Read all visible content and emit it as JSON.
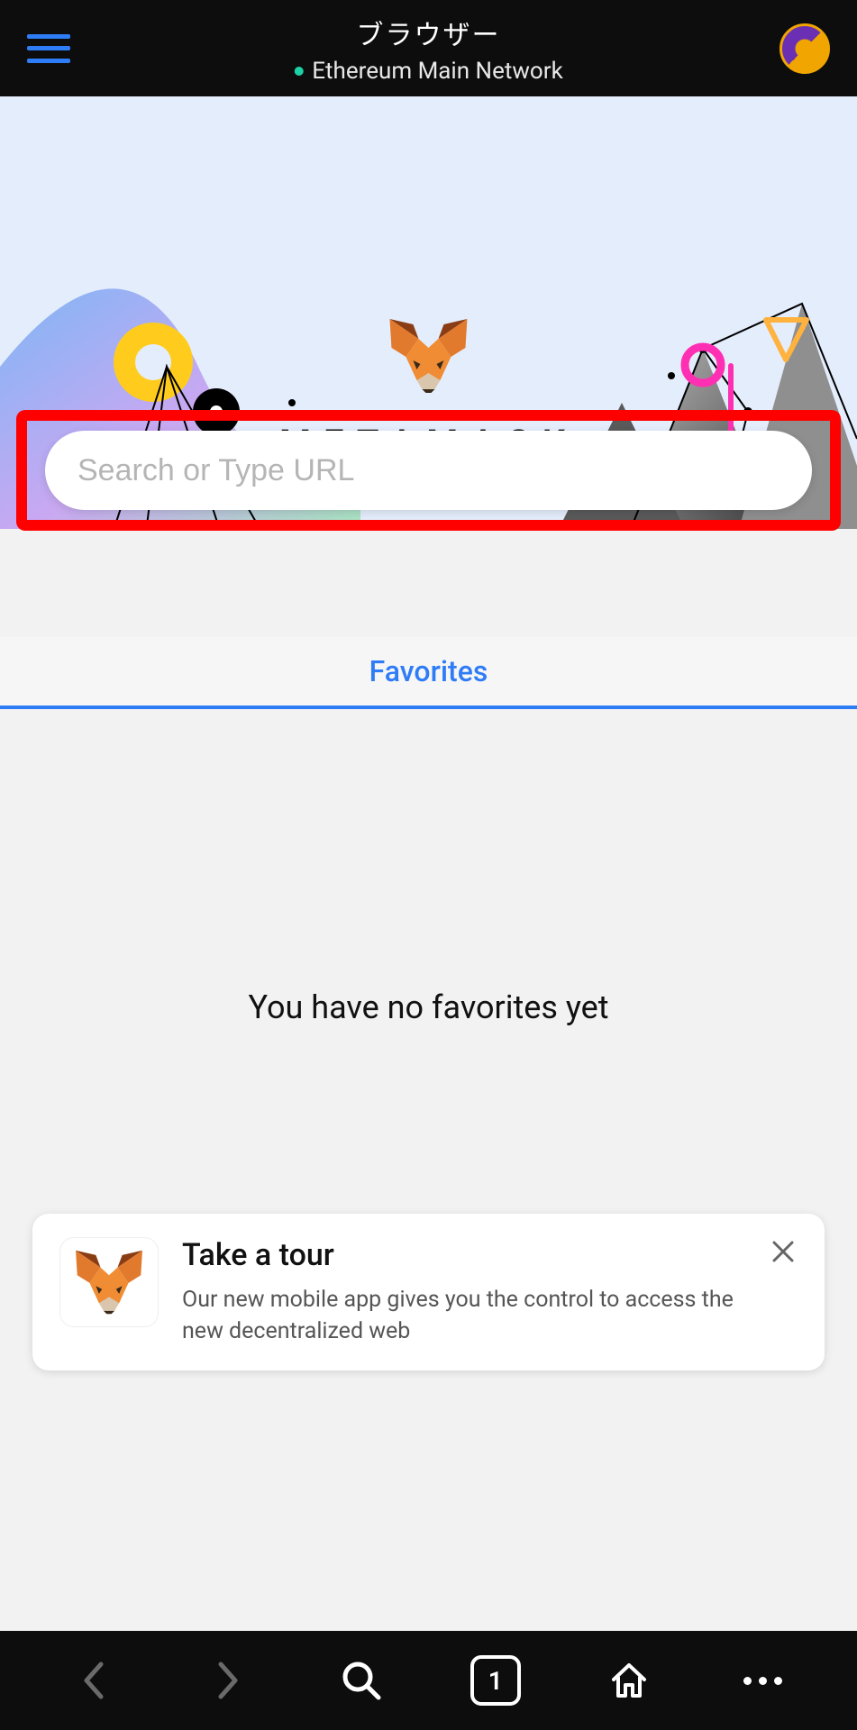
{
  "header": {
    "title": "ブラウザー",
    "network": "Ethereum Main Network"
  },
  "brand": {
    "name": "METAMASK"
  },
  "search": {
    "placeholder": "Search or Type URL",
    "value": ""
  },
  "tabs": {
    "favorites_label": "Favorites"
  },
  "empty": {
    "message": "You have no favorites yet"
  },
  "tour": {
    "title": "Take a tour",
    "description": "Our new mobile app gives you the control to access the new decentralized web"
  },
  "bottombar": {
    "tab_count": "1"
  }
}
